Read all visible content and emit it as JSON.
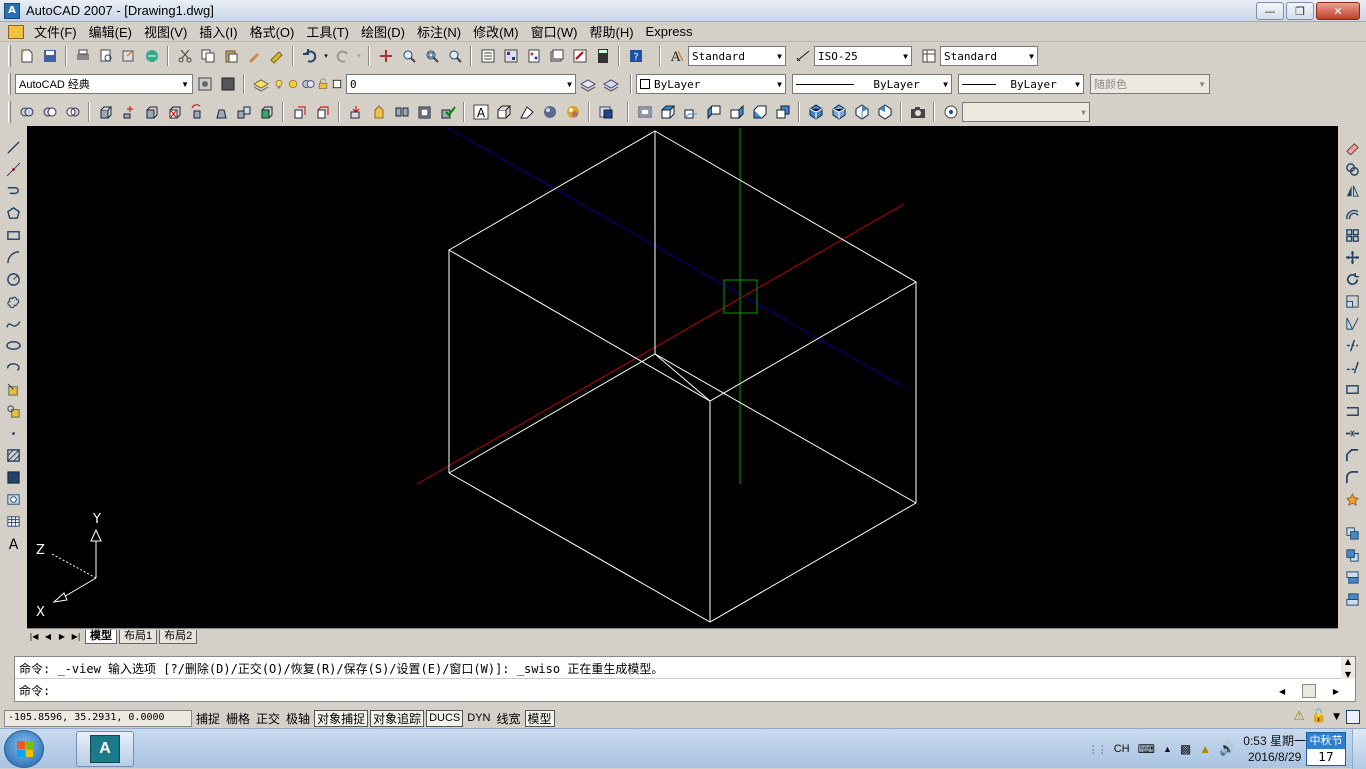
{
  "window": {
    "title": "AutoCAD 2007 - [Drawing1.dwg]",
    "app_icon_glyph": "A"
  },
  "menu": [
    "文件(F)",
    "编辑(E)",
    "视图(V)",
    "插入(I)",
    "格式(O)",
    "工具(T)",
    "绘图(D)",
    "标注(N)",
    "修改(M)",
    "窗口(W)",
    "帮助(H)",
    "Express"
  ],
  "toolbar2": {
    "text_style": "Standard",
    "dim_style": "ISO-25",
    "table_style": "Standard"
  },
  "toolbar3": {
    "workspace": "AutoCAD 经典",
    "layer": "0",
    "color": "ByLayer",
    "linetype": "ByLayer",
    "lineweight": "ByLayer",
    "plot_style": "随颜色"
  },
  "ucs": {
    "x": "X",
    "y": "Y",
    "z": "Z"
  },
  "tabs": [
    "模型",
    "布局1",
    "布局2"
  ],
  "command": {
    "history": "命令: _-view 输入选项 [?/删除(D)/正交(O)/恢复(R)/保存(S)/设置(E)/窗口(W)]: _swiso 正在重生成模型。",
    "prompt": "命令:"
  },
  "status": {
    "coords": "-105.8596, 35.2931, 0.0000",
    "buttons": [
      {
        "label": "捕捉",
        "on": false
      },
      {
        "label": "栅格",
        "on": false
      },
      {
        "label": "正交",
        "on": false
      },
      {
        "label": "极轴",
        "on": false
      },
      {
        "label": "对象捕捉",
        "on": true
      },
      {
        "label": "对象追踪",
        "on": true
      },
      {
        "label": "DUCS",
        "on": true
      },
      {
        "label": "DYN",
        "on": false
      },
      {
        "label": "线宽",
        "on": false
      },
      {
        "label": "模型",
        "on": true
      }
    ]
  },
  "taskbar": {
    "lang": "CH",
    "time": "0:53 星期一",
    "date": "2016/8/29",
    "festival": "中秋节",
    "festival_day": "17"
  },
  "colors": {
    "canvas": "#000000",
    "wire": "#ffffff",
    "axis_x": "#c00000",
    "axis_y": "#00a000",
    "axis_z": "#000090",
    "cursor": "#00a000"
  }
}
